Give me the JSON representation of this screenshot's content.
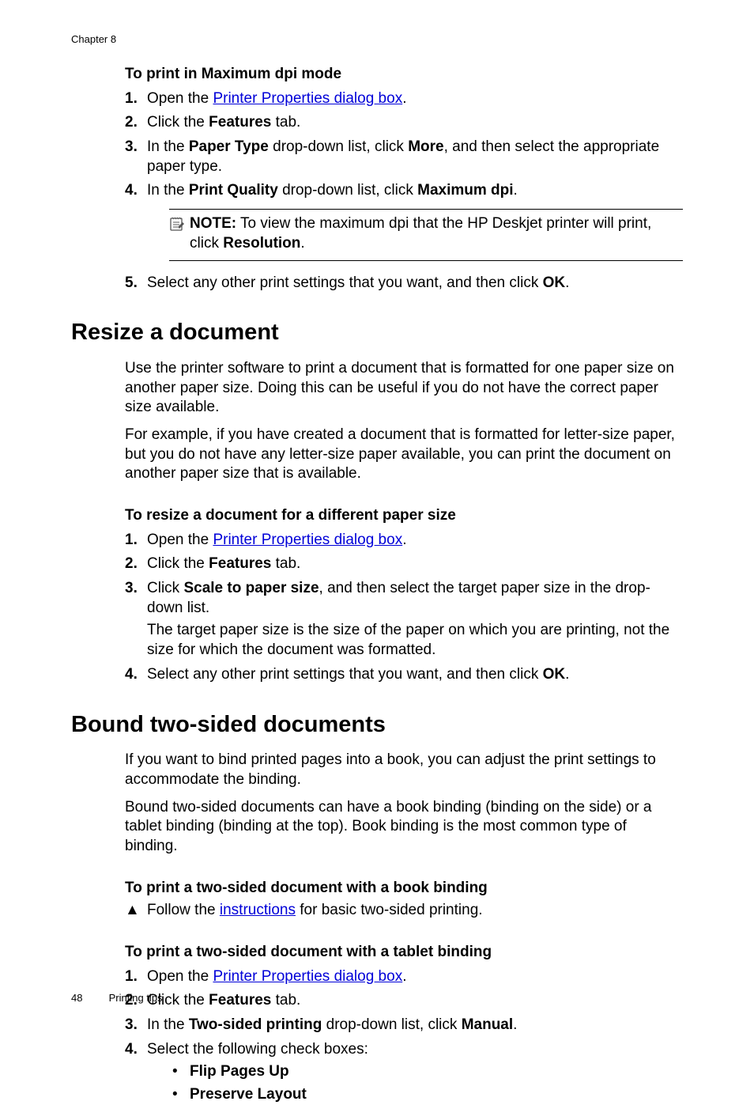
{
  "chapter": "Chapter 8",
  "sec1": {
    "heading": "To print in Maximum dpi mode",
    "s1_prefix": "Open the ",
    "s1_link": "Printer Properties dialog box",
    "s1_suffix": ".",
    "s2_a": "Click the ",
    "s2_b": "Features",
    "s2_c": " tab.",
    "s3_a": "In the ",
    "s3_b": "Paper Type",
    "s3_c": " drop-down list, click ",
    "s3_d": "More",
    "s3_e": ", and then select the appropriate paper type.",
    "s4_a": "In the ",
    "s4_b": "Print Quality",
    "s4_c": " drop-down list, click ",
    "s4_d": "Maximum dpi",
    "s4_e": ".",
    "note_label": "NOTE:",
    "note_a": "  To view the maximum dpi that the HP Deskjet printer will print, click ",
    "note_b": "Resolution",
    "note_c": ".",
    "s5_a": "Select any other print settings that you want, and then click ",
    "s5_b": "OK",
    "s5_c": "."
  },
  "resize": {
    "title": "Resize a document",
    "p1": "Use the printer software to print a document that is formatted for one paper size on another paper size. Doing this can be useful if you do not have the correct paper size available.",
    "p2": "For example, if you have created a document that is formatted for letter-size paper, but you do not have any letter-size paper available, you can print the document on another paper size that is available.",
    "sub": "To resize a document for a different paper size",
    "s1_prefix": "Open the ",
    "s1_link": "Printer Properties dialog box",
    "s1_suffix": ".",
    "s2_a": "Click the ",
    "s2_b": "Features",
    "s2_c": " tab.",
    "s3_a": "Click ",
    "s3_b": "Scale to paper size",
    "s3_c": ", and then select the target paper size in the drop-down list.",
    "s3_cont": "The target paper size is the size of the paper on which you are printing, not the size for which the document was formatted.",
    "s4_a": "Select any other print settings that you want, and then click ",
    "s4_b": "OK",
    "s4_c": "."
  },
  "bound": {
    "title": "Bound two-sided documents",
    "p1": "If you want to bind printed pages into a book, you can adjust the print settings to accommodate the binding.",
    "p2": "Bound two-sided documents can have a book binding (binding on the side) or a tablet binding (binding at the top). Book binding is the most common type of binding.",
    "sub1": "To print a two-sided document with a book binding",
    "tri_a": "Follow the ",
    "tri_link": "instructions",
    "tri_b": " for basic two-sided printing.",
    "sub2": "To print a two-sided document with a tablet binding",
    "s1_prefix": "Open the ",
    "s1_link": "Printer Properties dialog box",
    "s1_suffix": ".",
    "s2_a": "Click the ",
    "s2_b": "Features",
    "s2_c": " tab.",
    "s3_a": "In the ",
    "s3_b": "Two-sided printing",
    "s3_c": " drop-down list, click ",
    "s3_d": "Manual",
    "s3_e": ".",
    "s4": "Select the following check boxes:",
    "b1": "Flip Pages Up",
    "b2": "Preserve Layout"
  },
  "footer": {
    "page": "48",
    "section": "Printing tips"
  },
  "nums": {
    "n1": "1.",
    "n2": "2.",
    "n3": "3.",
    "n4": "4.",
    "n5": "5."
  },
  "glyphs": {
    "tri": "▲",
    "dot": "•"
  }
}
